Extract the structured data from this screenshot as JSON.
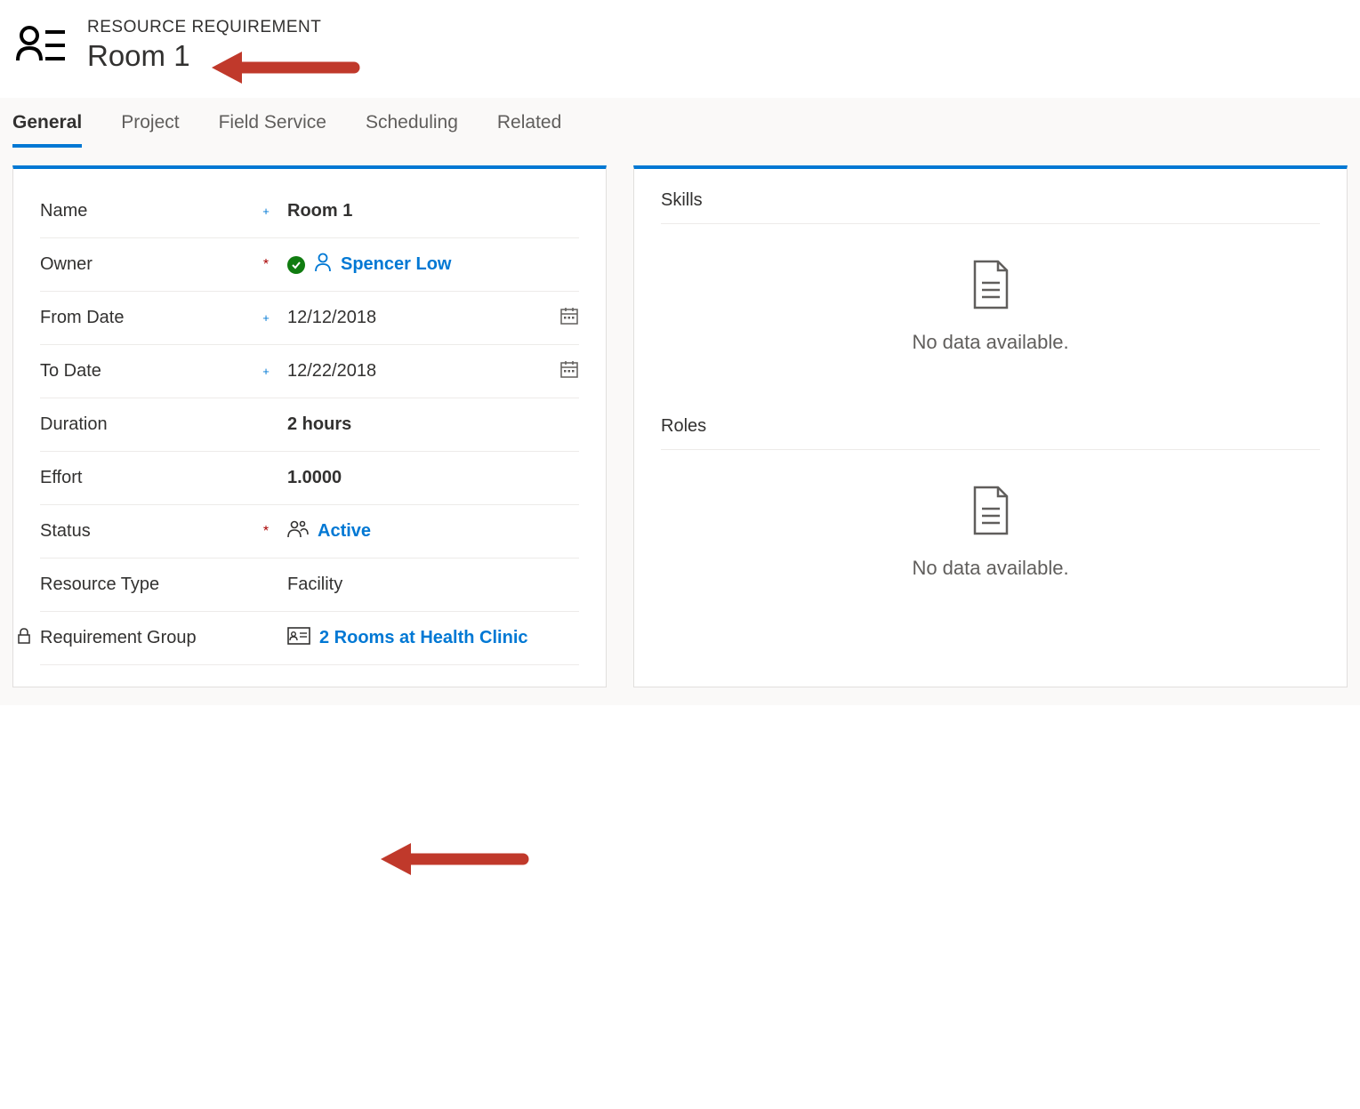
{
  "header": {
    "entityType": "RESOURCE REQUIREMENT",
    "title": "Room 1"
  },
  "tabs": [
    {
      "label": "General",
      "active": true
    },
    {
      "label": "Project",
      "active": false
    },
    {
      "label": "Field Service",
      "active": false
    },
    {
      "label": "Scheduling",
      "active": false
    },
    {
      "label": "Related",
      "active": false
    }
  ],
  "form": {
    "name": {
      "label": "Name",
      "value": "Room 1",
      "indicator": "+"
    },
    "owner": {
      "label": "Owner",
      "value": "Spencer Low",
      "indicator": "*"
    },
    "fromDate": {
      "label": "From Date",
      "value": "12/12/2018",
      "indicator": "+"
    },
    "toDate": {
      "label": "To Date",
      "value": "12/22/2018",
      "indicator": "+"
    },
    "duration": {
      "label": "Duration",
      "value": "2 hours"
    },
    "effort": {
      "label": "Effort",
      "value": "1.0000"
    },
    "status": {
      "label": "Status",
      "value": "Active",
      "indicator": "*"
    },
    "resourceType": {
      "label": "Resource Type",
      "value": "Facility"
    },
    "requirementGroup": {
      "label": "Requirement Group",
      "value": "2 Rooms at Health Clinic",
      "locked": true
    }
  },
  "sections": {
    "skills": {
      "title": "Skills",
      "noData": "No data available."
    },
    "roles": {
      "title": "Roles",
      "noData": "No data available."
    }
  }
}
